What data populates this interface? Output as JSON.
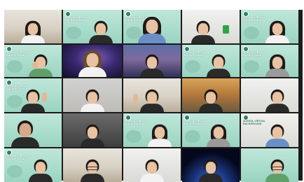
{
  "meeting": {
    "view": "gallery",
    "tiles": [
      {
        "row": 1,
        "col": 1,
        "background": "room",
        "participant": "student"
      },
      {
        "row": 1,
        "col": 2,
        "background": "mint",
        "participant": "student",
        "label": "SCHOOL VIRTUAL BACKGROUND"
      },
      {
        "row": 1,
        "col": 3,
        "background": "mint",
        "participant": "student",
        "label": "SCHOOL VIRTUAL BACKGROUND"
      },
      {
        "row": 1,
        "col": 4,
        "background": "white",
        "participant": "student",
        "prop": "green-can"
      },
      {
        "row": 1,
        "col": 5,
        "background": "mint",
        "participant": "student",
        "label": "SCHOOL VIRTUAL BACKGROUND"
      },
      {
        "row": 2,
        "col": 1,
        "background": "mint",
        "participant": "student",
        "label": "SCHOOL VIRTUAL BACKGROUND"
      },
      {
        "row": 2,
        "col": 2,
        "background": "space",
        "participant": "student"
      },
      {
        "row": 2,
        "col": 3,
        "background": "city",
        "participant": "student"
      },
      {
        "row": 2,
        "col": 4,
        "background": "mint",
        "participant": "student",
        "label": "SCHOOL VIRTUAL BACKGROUND"
      },
      {
        "row": 2,
        "col": 5,
        "background": "mint",
        "participant": "student",
        "label": "SCHOOL VIRTUAL BACKGROUND"
      },
      {
        "row": 3,
        "col": 1,
        "background": "mint",
        "participant": "student",
        "label": "SCHOOL VIRTUAL BACKGROUND",
        "gesture": "peace"
      },
      {
        "row": 3,
        "col": 2,
        "background": "gray",
        "participant": "student"
      },
      {
        "row": 3,
        "col": 3,
        "background": "room",
        "participant": "student",
        "gesture": "peace"
      },
      {
        "row": 3,
        "col": 4,
        "background": "autumn",
        "participant": "student"
      },
      {
        "row": 3,
        "col": 5,
        "background": "white",
        "participant": "student"
      },
      {
        "row": 4,
        "col": 1,
        "background": "mint",
        "participant": "teacher"
      },
      {
        "row": 4,
        "col": 2,
        "background": "dim",
        "participant": "student"
      },
      {
        "row": 4,
        "col": 3,
        "background": "mint",
        "participant": "student",
        "label": "SCHOOL VIRTUAL BACKGROUND"
      },
      {
        "row": 4,
        "col": 4,
        "background": "mint",
        "participant": "student",
        "label": "SCHOOL VIRTUAL BACKGROUND"
      },
      {
        "row": 4,
        "col": 5,
        "background": "white",
        "participant": "student",
        "label": "SCHOOL VIRTUAL BACKGROUND"
      },
      {
        "row": 5,
        "col": 1,
        "background": "mint",
        "participant": "student",
        "label": "SCHOOL VIRTUAL BACKGROUND"
      },
      {
        "row": 5,
        "col": 2,
        "background": "room",
        "participant": "student"
      },
      {
        "row": 5,
        "col": 3,
        "background": "white",
        "participant": "student"
      },
      {
        "row": 5,
        "col": 4,
        "background": "planet",
        "participant": "student"
      },
      {
        "row": 5,
        "col": 5,
        "background": "mint",
        "participant": "student"
      }
    ]
  },
  "colors": {
    "grid_gap": "#1c1c1c",
    "school_mint": "#a8dccb",
    "school_accent": "#2f7d68"
  }
}
